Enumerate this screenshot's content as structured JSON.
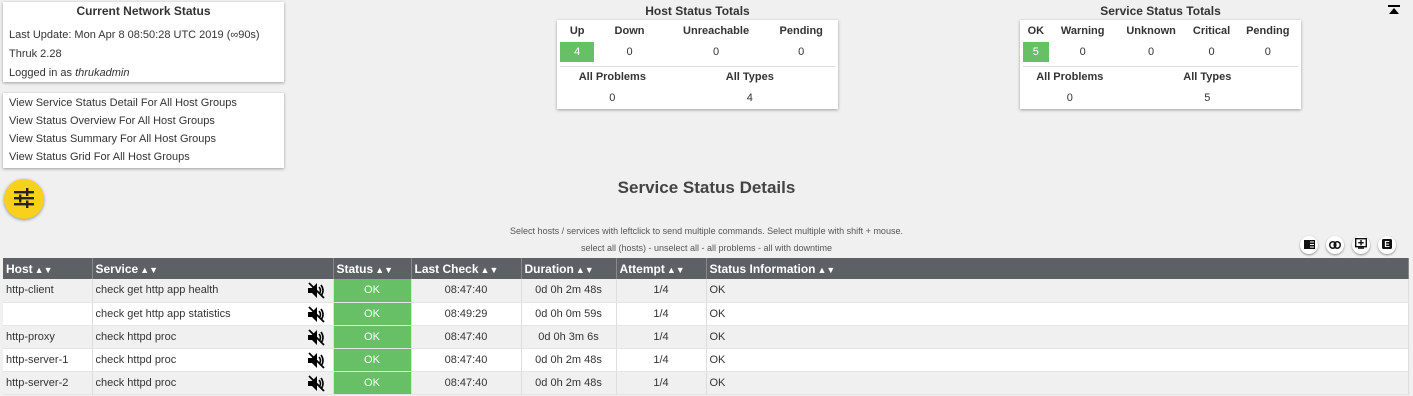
{
  "status_box": {
    "title": "Current Network Status",
    "last_update": "Last Update: Mon Apr 8 08:50:28 UTC 2019 (∞90s)",
    "version": "Thruk 2.28",
    "logged_in_prefix": "Logged in as ",
    "user": "thrukadmin"
  },
  "links": [
    "View Service Status Detail For All Host Groups",
    "View Status Overview For All Host Groups",
    "View Status Summary For All Host Groups",
    "View Status Grid For All Host Groups"
  ],
  "host_totals": {
    "title": "Host Status Totals",
    "headers": [
      "Up",
      "Down",
      "Unreachable",
      "Pending"
    ],
    "values": [
      "4",
      "0",
      "0",
      "0"
    ],
    "problems_label": "All Problems",
    "types_label": "All Types",
    "problems": "0",
    "types": "4"
  },
  "service_totals": {
    "title": "Service Status Totals",
    "headers": [
      "OK",
      "Warning",
      "Unknown",
      "Critical",
      "Pending"
    ],
    "values": [
      "5",
      "0",
      "0",
      "0",
      "0"
    ],
    "problems_label": "All Problems",
    "types_label": "All Types",
    "problems": "0",
    "types": "5"
  },
  "page_title": "Service Status Details",
  "hint1": "Select hosts / services with leftclick to send multiple commands. Select multiple with shift + mouse.",
  "hint2": "select all (hosts) - unselect all - all problems - all with downtime",
  "table": {
    "headers": [
      "Host",
      "Service",
      "Status",
      "Last Check",
      "Duration",
      "Attempt",
      "Status Information"
    ],
    "rows": [
      {
        "host": "http-client",
        "service": "check get http app health",
        "status": "OK",
        "last_check": "08:47:40",
        "duration": "0d 0h 2m 48s",
        "attempt": "1/4",
        "info": "OK"
      },
      {
        "host": "",
        "service": "check get http app statistics",
        "status": "OK",
        "last_check": "08:49:29",
        "duration": "0d 0h 0m 59s",
        "attempt": "1/4",
        "info": "OK"
      },
      {
        "host": "http-proxy",
        "service": "check httpd proc",
        "status": "OK",
        "last_check": "08:47:40",
        "duration": "0d 0h 3m 6s",
        "attempt": "1/4",
        "info": "OK"
      },
      {
        "host": "http-server-1",
        "service": "check httpd proc",
        "status": "OK",
        "last_check": "08:47:40",
        "duration": "0d 0h 2m 48s",
        "attempt": "1/4",
        "info": "OK"
      },
      {
        "host": "http-server-2",
        "service": "check httpd proc",
        "status": "OK",
        "last_check": "08:47:40",
        "duration": "0d 0h 2m 48s",
        "attempt": "1/4",
        "info": "OK"
      }
    ]
  },
  "colors": {
    "ok_green": "#67c066",
    "header_bg": "#5d6064",
    "fab_yellow": "#f9d11c"
  },
  "icons": [
    "filter-icon",
    "collapse-icon",
    "columns-icon",
    "link-icon",
    "add-icon",
    "export-icon",
    "muted-icon"
  ]
}
